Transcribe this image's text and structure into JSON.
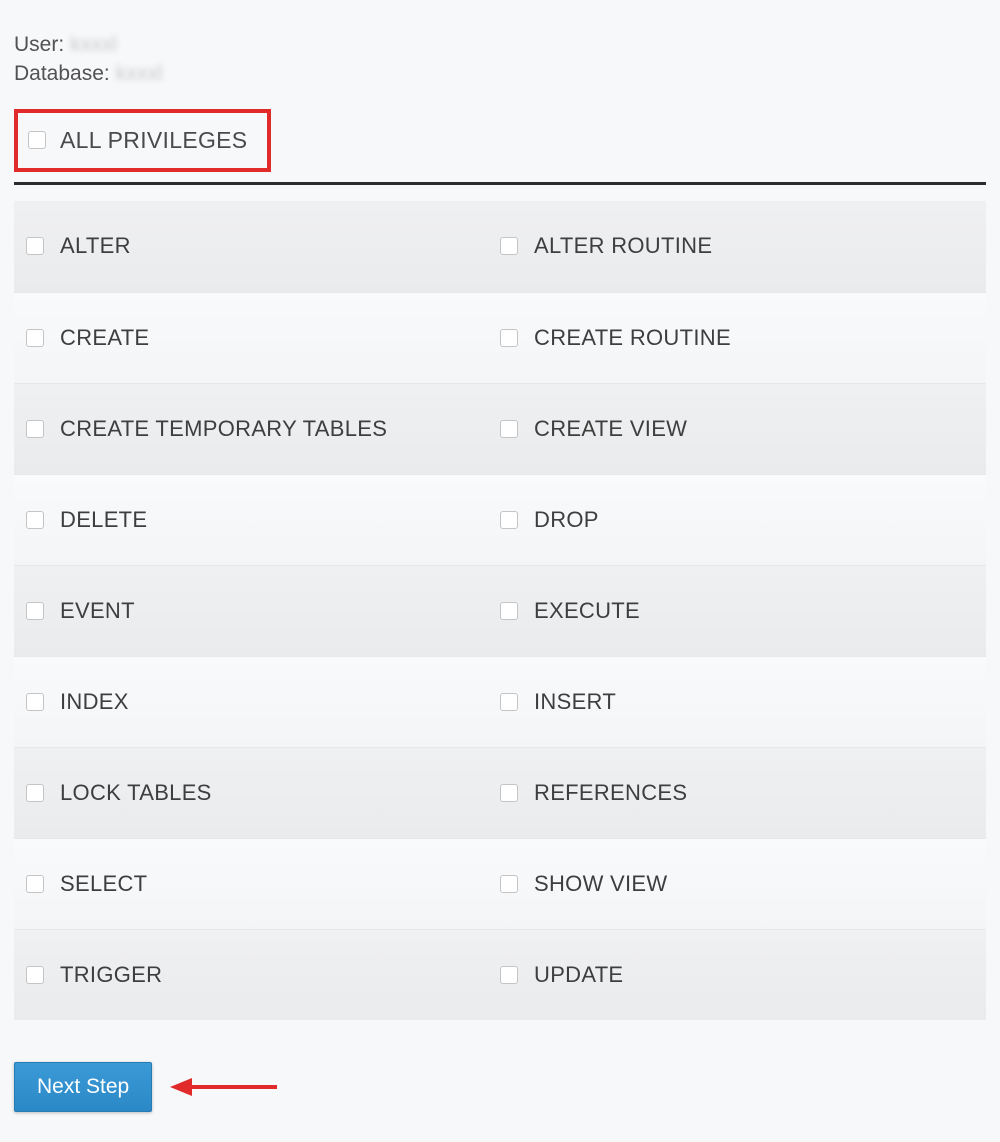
{
  "header": {
    "user_label": "User:",
    "user_value": "kxxxl",
    "database_label": "Database:",
    "database_value": "kxxxl"
  },
  "all_privileges_label": "ALL PRIVILEGES",
  "privileges": [
    {
      "left": "ALTER",
      "right": "ALTER ROUTINE"
    },
    {
      "left": "CREATE",
      "right": "CREATE ROUTINE"
    },
    {
      "left": "CREATE TEMPORARY TABLES",
      "right": "CREATE VIEW"
    },
    {
      "left": "DELETE",
      "right": "DROP"
    },
    {
      "left": "EVENT",
      "right": "EXECUTE"
    },
    {
      "left": "INDEX",
      "right": "INSERT"
    },
    {
      "left": "LOCK TABLES",
      "right": "REFERENCES"
    },
    {
      "left": "SELECT",
      "right": "SHOW VIEW"
    },
    {
      "left": "TRIGGER",
      "right": "UPDATE"
    }
  ],
  "next_button_label": "Next Step",
  "annotation_colors": {
    "highlight_box": "#e12a2a",
    "arrow": "#e12a2a"
  }
}
